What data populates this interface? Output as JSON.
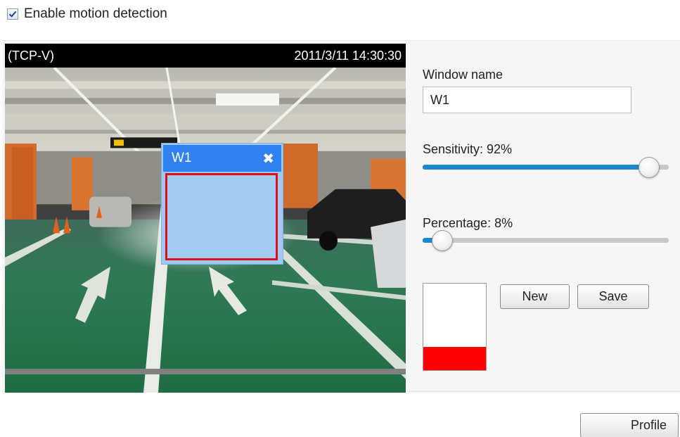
{
  "enable_motion": {
    "label": "Enable motion detection",
    "checked": true
  },
  "video": {
    "protocol": "(TCP-V)",
    "timestamp": "2011/3/11 14:30:30"
  },
  "motion_window": {
    "name": "W1",
    "close_icon": "close-icon"
  },
  "window_name": {
    "label": "Window name",
    "value": "W1"
  },
  "sensitivity": {
    "label": "Sensitivity: 92%",
    "value": 0.92
  },
  "percentage": {
    "label": "Percentage: 8%",
    "value": 0.08
  },
  "activity_meter": {
    "level": 0.27,
    "color": "#ff0000"
  },
  "buttons": {
    "new": "New",
    "save": "Save",
    "profile": "Profile"
  },
  "colors": {
    "slider_fill": "#1f86d0",
    "window_title": "#2f82ef",
    "window_border": "#9ec9f0",
    "detect_area": "#e0101a"
  }
}
